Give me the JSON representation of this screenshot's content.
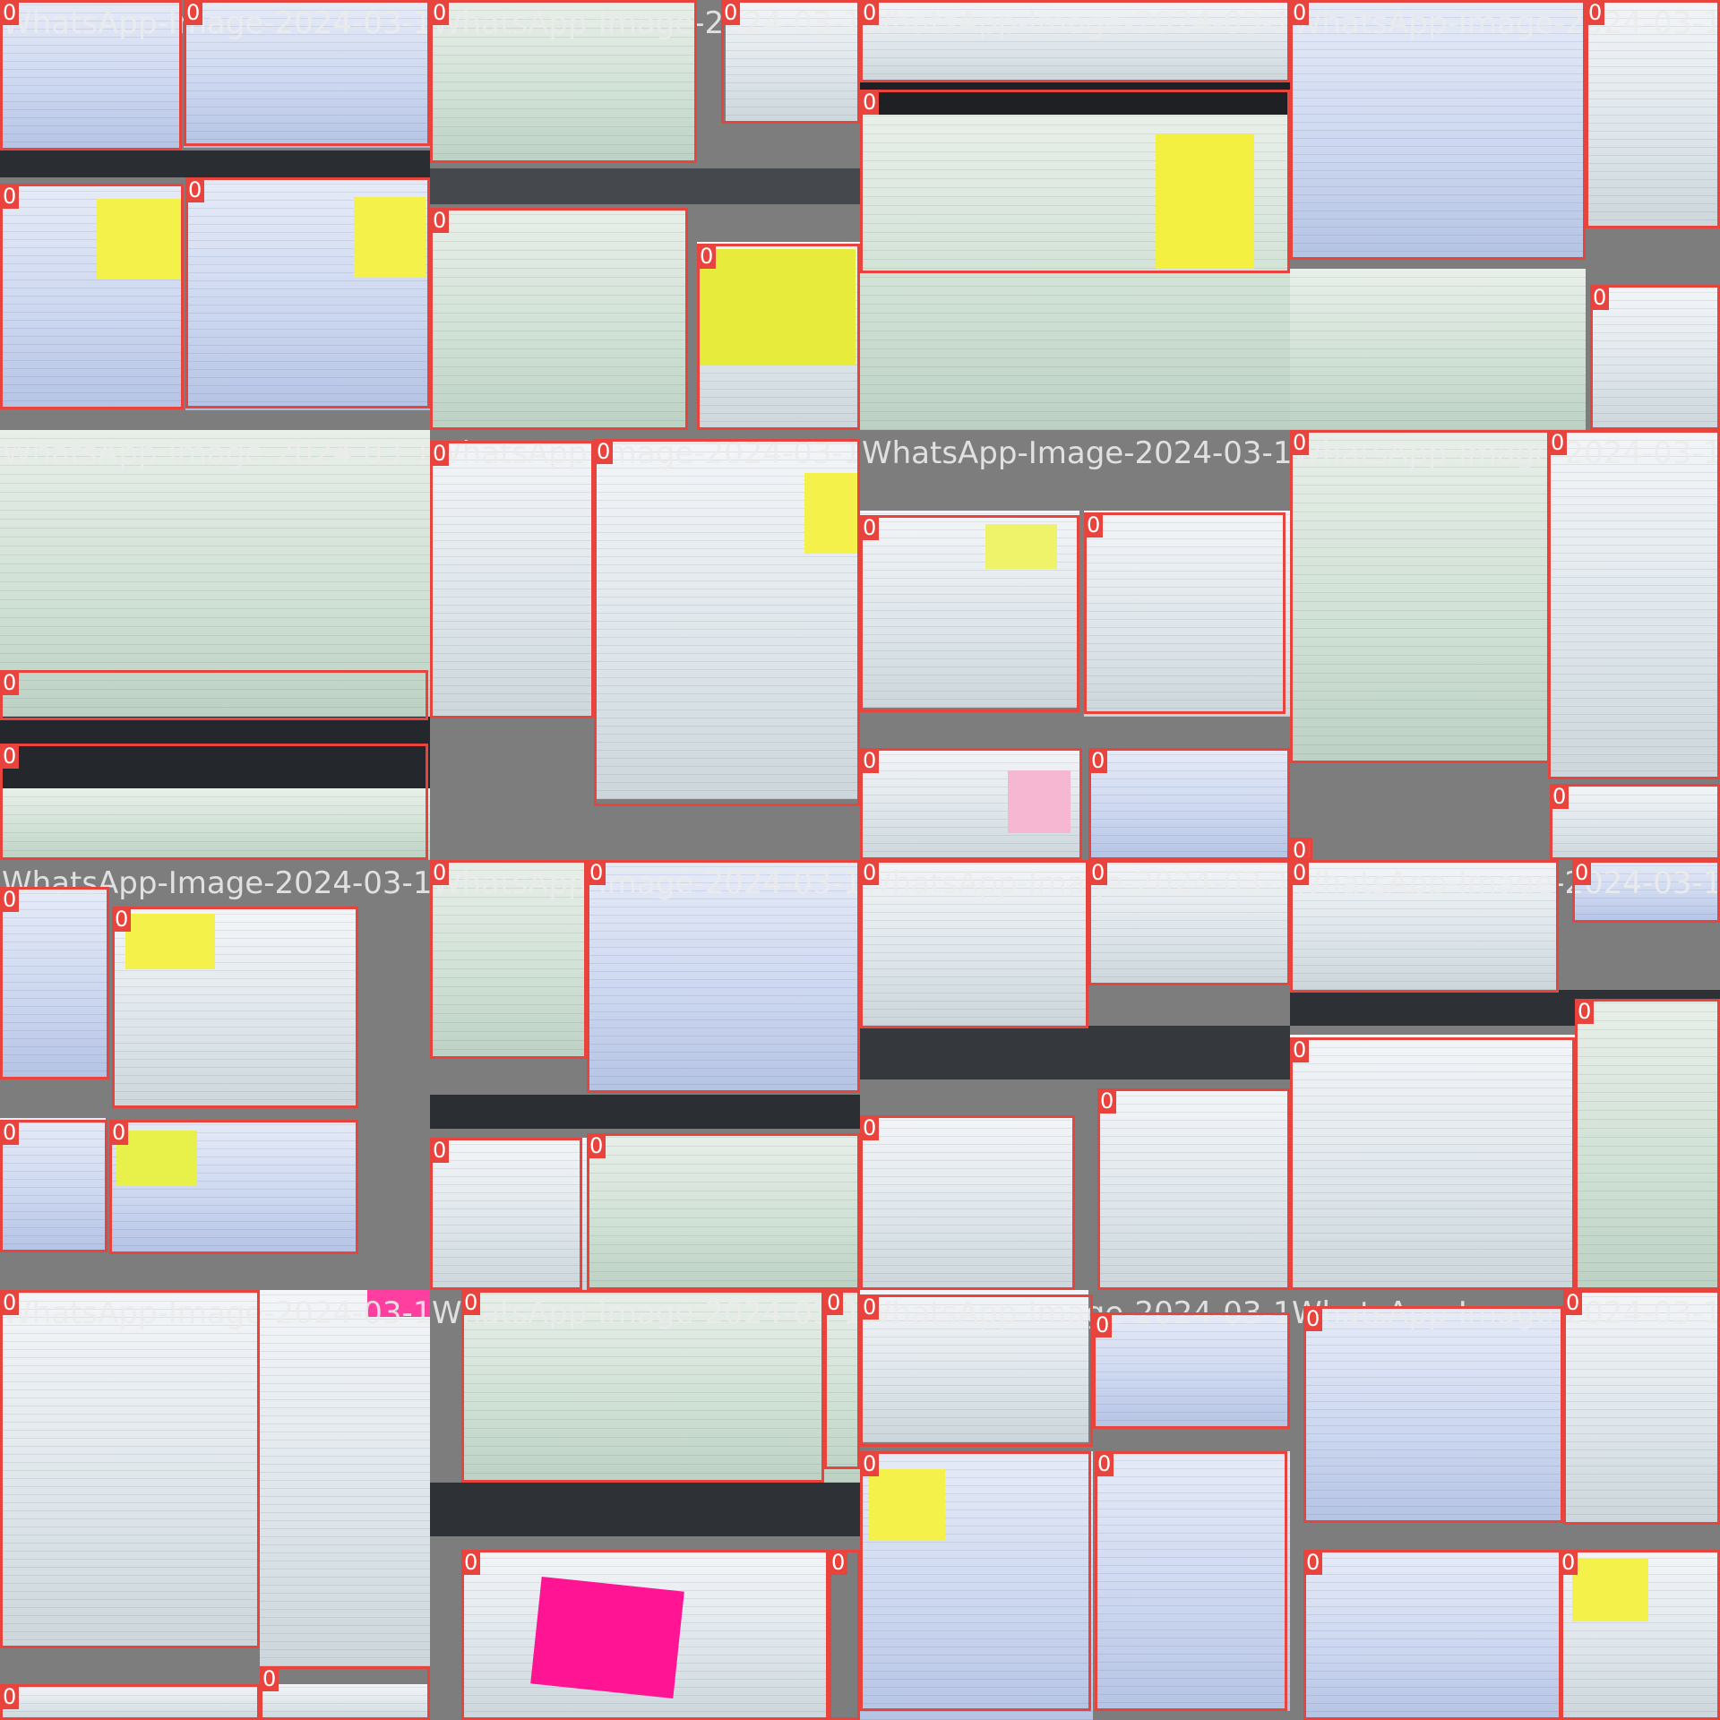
{
  "class_label": "0",
  "colors": {
    "box": "#e8443d",
    "label_text": "#ffffff",
    "yellow_note": "#f4f24a",
    "pink_note": "#ff1493",
    "light_pink_note": "#f6b7d2"
  },
  "captions": [
    "WhatsApp-Image-2024-03-1",
    "WhatsApp-Image-2024-03-1",
    "WhatsApp-Image-2024-03-1",
    "WhatsApp-Image-2024-03-1",
    "WhatsApp-Image-2024-03-1",
    "WhatsApp-Image-2024-03-1",
    "WhatsApp-Image-2024-03-1",
    "WhatsApp-Image-2024-03-1",
    "WhatsApp-Image-2024-03-1",
    "WhatsApp-Image-2024-03-1",
    "WhatsApp-Image-2024-03-1",
    "WhatsApp-Image-2024-03-1",
    "WhatsApp-Image-2024-03-1",
    "WhatsApp-Image-2024-03-1",
    "WhatsApp-Image-2024-03-1",
    "WhatsApp-Image-2024-03-1"
  ]
}
